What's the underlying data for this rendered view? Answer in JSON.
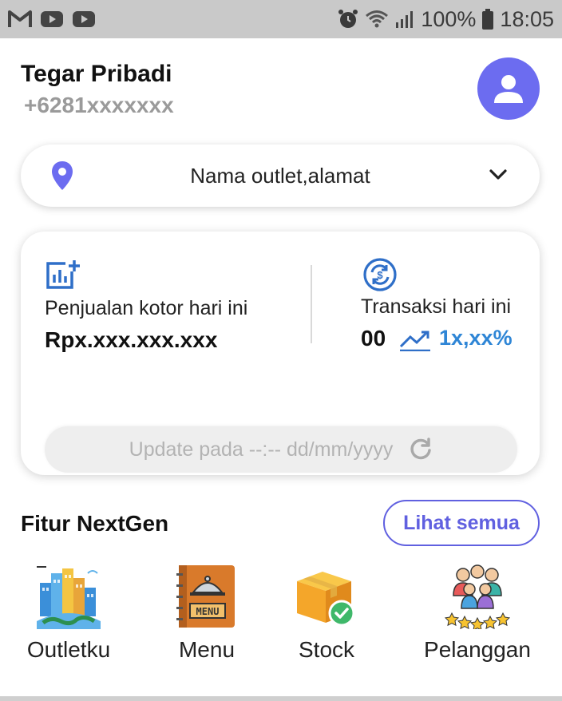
{
  "status_bar": {
    "battery": "100%",
    "time": "18:05",
    "icons": [
      "gmail-icon",
      "youtube-icon",
      "youtube-icon",
      "alarm-icon",
      "wifi-icon",
      "signal-icon",
      "battery-icon"
    ]
  },
  "user": {
    "name": "Tegar Pribadi",
    "phone": "+6281xxxxxxx",
    "avatar_color": "#6c6cf0"
  },
  "outlet": {
    "label": "Nama outlet,alamat",
    "accent": "#6c6cf0"
  },
  "summary": {
    "gross_sales_label": "Penjualan kotor hari ini",
    "gross_sales_value": "Rpx.xxx.xxx.xxx",
    "transactions_label": "Transaksi hari ini",
    "transactions_count": "00",
    "transactions_change": "1x,xx%",
    "update_text": "Update pada --:-- dd/mm/yyyy",
    "change_color": "#2f86d6"
  },
  "features": {
    "title": "Fitur NextGen",
    "see_all": "Lihat semua",
    "items": [
      {
        "label": "Outletku",
        "icon": "city-icon"
      },
      {
        "label": "Menu",
        "icon": "menu-book-icon"
      },
      {
        "label": "Stock",
        "icon": "box-check-icon"
      },
      {
        "label": "Pelanggan",
        "icon": "customers-icon"
      }
    ]
  }
}
